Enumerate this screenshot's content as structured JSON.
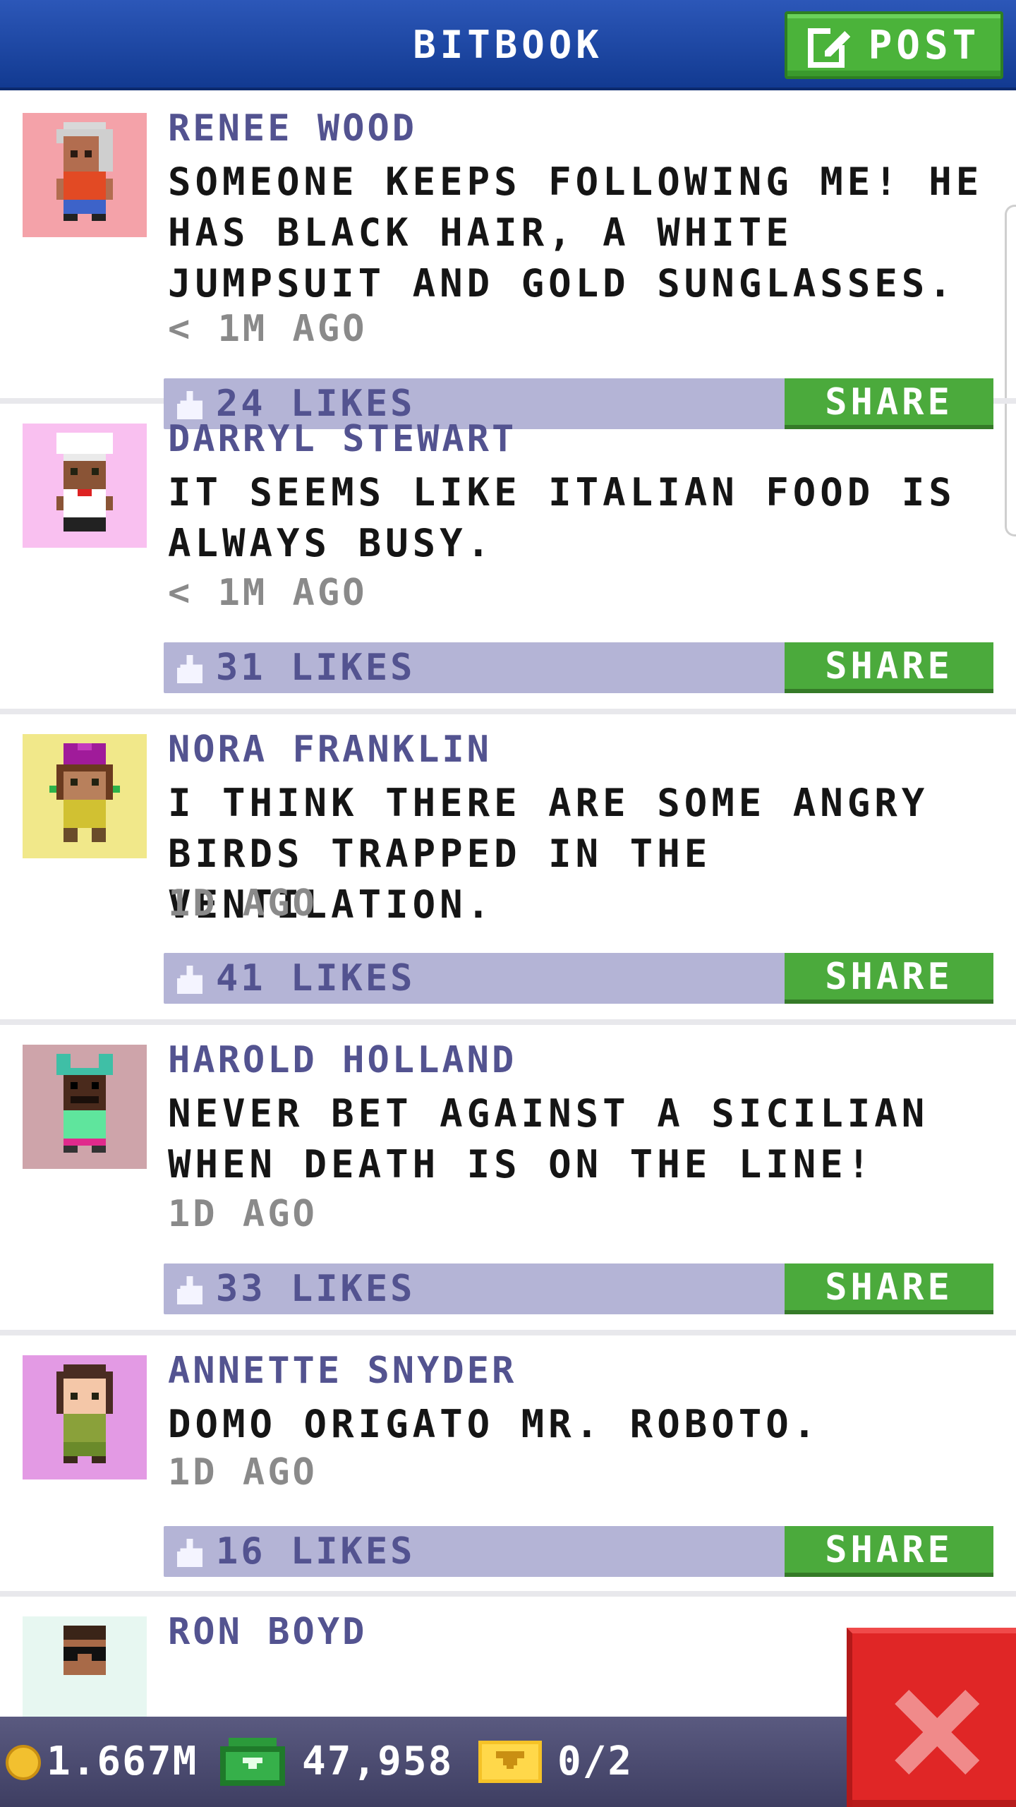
{
  "header": {
    "title": "BITBOOK",
    "post_label": "POST"
  },
  "posts": [
    {
      "author": "RENEE WOOD",
      "text": "SOMEONE KEEPS FOLLOWING ME! HE HAS BLACK HAIR, A WHITE JUMPSUIT AND GOLD SUNGLASSES.",
      "time": "< 1M AGO",
      "likes": "24 LIKES",
      "share": "SHARE",
      "avatar_bg": "#f4a2a9"
    },
    {
      "author": "DARRYL STEWART",
      "text": "IT SEEMS LIKE ITALIAN FOOD IS ALWAYS BUSY.",
      "time": "< 1M AGO",
      "likes": "31 LIKES",
      "share": "SHARE",
      "avatar_bg": "#f9c0f0"
    },
    {
      "author": "NORA FRANKLIN",
      "text": "I THINK THERE ARE SOME ANGRY BIRDS TRAPPED IN THE VENTILATION.",
      "time": "1D AGO",
      "likes": "41 LIKES",
      "share": "SHARE",
      "avatar_bg": "#f1e88a"
    },
    {
      "author": "HAROLD HOLLAND",
      "text": "NEVER BET AGAINST A SICILIAN WHEN DEATH IS ON THE LINE!",
      "time": "1D AGO",
      "likes": "33 LIKES",
      "share": "SHARE",
      "avatar_bg": "#cea4aa"
    },
    {
      "author": "ANNETTE SNYDER",
      "text": "DOMO ORIGATO MR. ROBOTO.",
      "time": "1D AGO",
      "likes": "16 LIKES",
      "share": "SHARE",
      "avatar_bg": "#e39ae4"
    },
    {
      "author": "RON BOYD",
      "avatar_bg": "#e7f7f1"
    }
  ],
  "status": {
    "coins": "1.667M",
    "bux": "47,958",
    "tickets": "0/2"
  },
  "colors": {
    "header": "#1c46a6",
    "green": "#4bb33a",
    "like_bar": "#b4b4d6",
    "name": "#535390",
    "close": "#e02626"
  },
  "icons": {
    "post": "edit-icon",
    "like": "thumbs-up-icon",
    "close": "close-icon",
    "coin": "coin-icon",
    "bux": "cash-icon",
    "ticket": "ticket-icon"
  }
}
